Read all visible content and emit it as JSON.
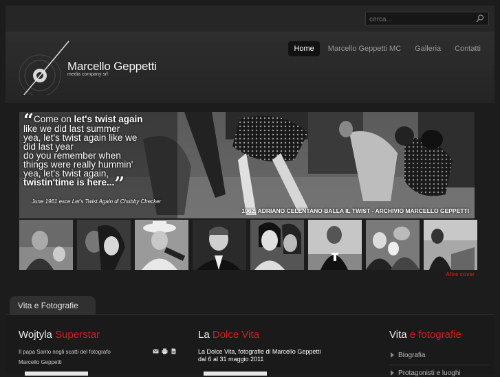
{
  "search": {
    "placeholder": "cerca..."
  },
  "brand": {
    "name": "Marcello Geppetti",
    "subtitle": "media company srl"
  },
  "nav": {
    "items": [
      "Home",
      "Marcello Geppetti MC",
      "Galleria",
      "Contatti"
    ],
    "active": "Home"
  },
  "hero": {
    "quote_lines": [
      {
        "pre": "Come on ",
        "bold": "let's twist again",
        "post": ""
      },
      {
        "pre": "like we did last summer",
        "bold": "",
        "post": ""
      },
      {
        "pre": "yea, let's twist again like we",
        "bold": "",
        "post": ""
      },
      {
        "pre": "did last year",
        "bold": "",
        "post": ""
      },
      {
        "pre": "do you remember when",
        "bold": "",
        "post": ""
      },
      {
        "pre": "things were really hummin'",
        "bold": "",
        "post": ""
      },
      {
        "pre": "yea, let's twist again,",
        "bold": "",
        "post": ""
      },
      {
        "pre": "",
        "bold": "twistin'time is here...",
        "post": ""
      }
    ],
    "note": "June 1961 esce Let's Twist Again di Chubby Checker",
    "caption": "1962, ADRIANO CELENTANO  BALLA IL TWIST - ARCHIVIO MARCELLO GEPPETTI"
  },
  "thumbnails_count": 8,
  "more_covers": "Altre cover",
  "section_tab": "Vita e Fotografie",
  "columns": {
    "left": {
      "title_white": "Wojtyla ",
      "title_red": "Superstar",
      "line1": "Il papa Santo negli scatti del fotografo",
      "line2": "Marcello Geppetti"
    },
    "middle": {
      "title_white": "La ",
      "title_red": "Dolce Vita",
      "line1": "La Dolce Vita, fotografie di Marcello Geppetti",
      "line2": "dal 6 al 31 maggio 2011"
    },
    "right": {
      "title_white": "Vita ",
      "title_red": "e fotografie",
      "items": [
        "Biografia",
        "Protagonisti e luoghi"
      ]
    }
  },
  "colors": {
    "accent": "#d31f20",
    "background": "#1c1c1c",
    "nav_active": "#121212"
  }
}
